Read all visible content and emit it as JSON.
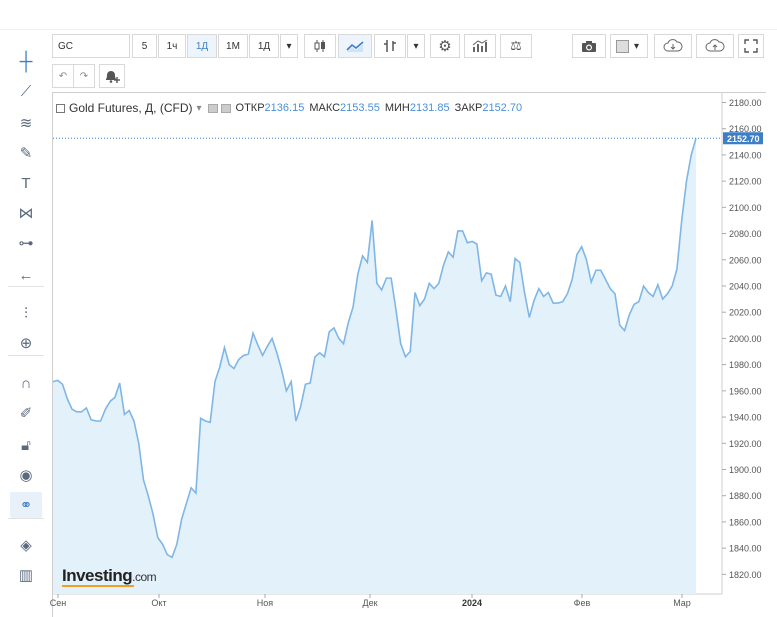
{
  "symbol": "GC",
  "intervals": [
    "5",
    "1ч",
    "1Д",
    "1М",
    "1Д"
  ],
  "selected_interval_index": 2,
  "legend": {
    "title": "Gold Futures, Д, (CFD)",
    "open_label": "ОТКР",
    "open_value": "2136.15",
    "high_label": "МАКС",
    "high_value": "2153.55",
    "low_label": "МИН",
    "low_value": "2131.85",
    "close_label": "ЗАКР",
    "close_value": "2152.70"
  },
  "watermark": {
    "brand": "Investing",
    "suffix": ".com"
  },
  "colors": {
    "line": "#7fb6e6",
    "fill": "#e3f1fa",
    "price_tag": "#3d7fc6",
    "accent": "#3d7fc6",
    "logo_underline": "#f0a020"
  },
  "left_tools": [
    "crosshair-icon",
    "trendline-icon",
    "fib-icon",
    "brush-icon",
    "text-icon",
    "pattern-icon",
    "measure-icon",
    "back-arrow-icon",
    "indicators-icon",
    "zoom-in-icon",
    "magnet-icon",
    "pencil-lock-icon",
    "lock-icon",
    "eye-icon",
    "link-icon",
    "layers-icon",
    "trash-icon"
  ],
  "toolbar_icons": [
    "candles-icon",
    "line-chart-icon",
    "bars-icon",
    "settings-icon",
    "indicators-icon",
    "compare-icon",
    "camera-icon",
    "color-box-icon",
    "cloud-download-icon",
    "cloud-upload-icon",
    "fullscreen-icon"
  ],
  "chart_data": {
    "type": "area",
    "title": "Gold Futures, Д, (CFD)",
    "xlabel": "",
    "ylabel": "",
    "x_ticks": [
      "Сен",
      "Окт",
      "Ноя",
      "Дек",
      "2024",
      "Фев",
      "Мар"
    ],
    "y_ticks": [
      "1820.00",
      "1840.00",
      "1860.00",
      "1880.00",
      "1900.00",
      "1920.00",
      "1940.00",
      "1960.00",
      "1980.00",
      "2000.00",
      "2020.00",
      "2040.00",
      "2060.00",
      "2080.00",
      "2100.00",
      "2120.00",
      "2140.00",
      "2160.00",
      "2180.00"
    ],
    "ylim": [
      1805,
      2188
    ],
    "last_price": "2152.70",
    "series": [
      {
        "values": [
          1967,
          1968,
          1965,
          1954,
          1946,
          1944,
          1944,
          1947,
          1938,
          1937,
          1937,
          1946,
          1952,
          1955,
          1966,
          1942,
          1945,
          1937,
          1920,
          1892,
          1880,
          1866,
          1848,
          1843,
          1835,
          1833,
          1843,
          1862,
          1874,
          1886,
          1882,
          1939,
          1937,
          1936,
          1967,
          1978,
          1993,
          1980,
          1977,
          1984,
          1987,
          1988,
          2004,
          1995,
          1987,
          1994,
          2000,
          1989,
          1976,
          1960,
          1967,
          1937,
          1948,
          1965,
          1966,
          1986,
          1989,
          1986,
          2005,
          2008,
          2000,
          1996,
          2012,
          2024,
          2049,
          2063,
          2058,
          2090,
          2042,
          2037,
          2046,
          2046,
          2022,
          1996,
          1986,
          1990,
          2035,
          2025,
          2030,
          2042,
          2038,
          2042,
          2056,
          2066,
          2062,
          2082,
          2082,
          2073,
          2074,
          2072,
          2044,
          2050,
          2049,
          2033,
          2032,
          2040,
          2028,
          2061,
          2058,
          2035,
          2016,
          2029,
          2038,
          2032,
          2035,
          2027,
          2027,
          2028,
          2034,
          2045,
          2064,
          2070,
          2060,
          2043,
          2052,
          2052,
          2045,
          2038,
          2034,
          2010,
          2006,
          2018,
          2026,
          2028,
          2040,
          2035,
          2032,
          2041,
          2030,
          2034,
          2040,
          2053,
          2090,
          2120,
          2140,
          2152.7
        ]
      }
    ]
  }
}
